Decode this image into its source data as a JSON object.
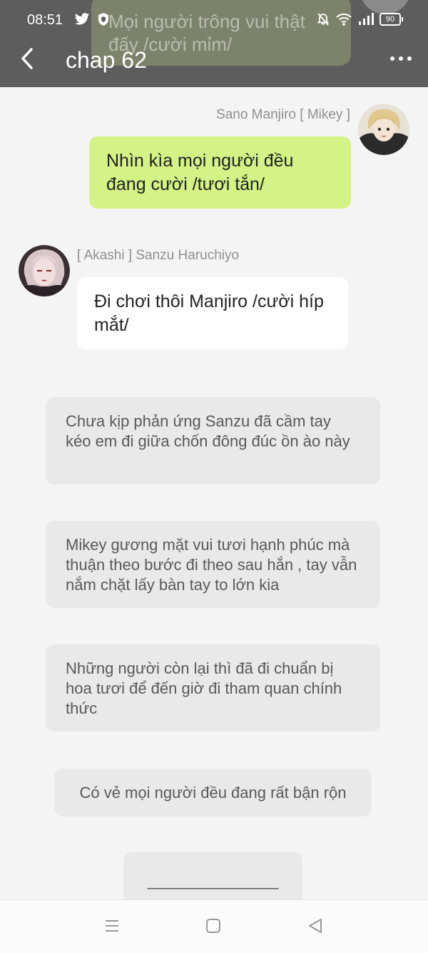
{
  "background_bubble": {
    "text": "Mọi người trông vui thật đấy /cười mỉm/"
  },
  "status_bar": {
    "time": "08:51",
    "battery": "90",
    "left_icons": [
      "twitter-icon",
      "shield-icon"
    ],
    "right_icons": [
      "bell-off-icon",
      "wifi-icon",
      "signal-icon",
      "battery-icon"
    ]
  },
  "app_bar": {
    "title": "chap 62",
    "back_icon": "chevron-left-icon",
    "more_icon": "more-horizontal-icon"
  },
  "messages": [
    {
      "sender": "Sano Manjiro [ Mikey ]",
      "text": "Nhìn kìa mọi người đều đang cười /tươi tắn/",
      "side": "right",
      "bubble_color": "#d4f285"
    },
    {
      "sender": "[ Akashi ] Sanzu Haruchiyo",
      "text": "Đi chơi thôi Manjiro /cười híp mắt/",
      "side": "left",
      "bubble_color": "#ffffff"
    }
  ],
  "narrations": [
    "Chưa kịp phản ứng Sanzu đã cầm tay kéo em đi giữa chốn đông đúc ồn ào này",
    "Mikey gương mặt vui tươi hạnh phúc mà thuận theo bước đi theo sau hắn , tay vẫn nắm chặt lấy bàn tay to lớn kia",
    "Những người còn lại thì đã đi chuẩn bị hoa tươi để đến giờ đi tham quan chính thức",
    "Có vẻ mọi người đều đang rất bận rộn",
    "_______________"
  ],
  "nav_bar": {
    "icons": [
      "menu-icon",
      "home-square-icon",
      "back-triangle-icon"
    ]
  },
  "colors": {
    "top_overlay": "#5d5d5d",
    "background": "#f4f4f4",
    "narration_bubble": "#e9e9e9"
  }
}
